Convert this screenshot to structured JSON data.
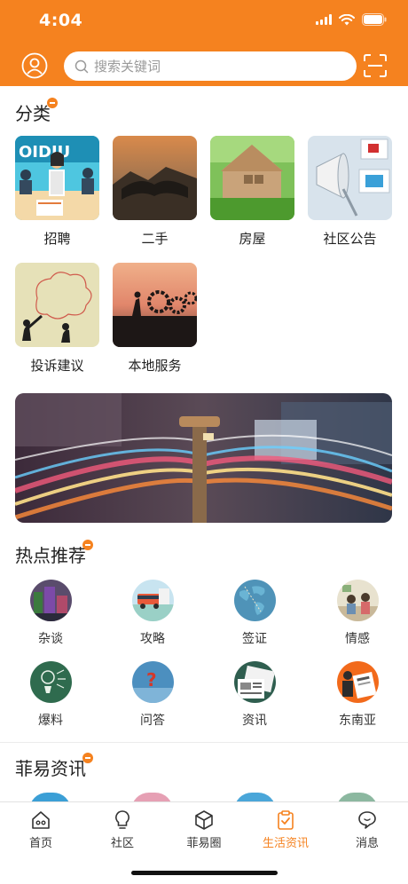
{
  "status_bar": {
    "time": "4:04"
  },
  "header": {
    "search_placeholder": "搜索关键词"
  },
  "categories_section": {
    "title": "分类",
    "items": [
      {
        "label": "招聘"
      },
      {
        "label": "二手"
      },
      {
        "label": "房屋"
      },
      {
        "label": "社区公告"
      },
      {
        "label": "投诉建议"
      },
      {
        "label": "本地服务"
      }
    ]
  },
  "hot_section": {
    "title": "热点推荐",
    "items": [
      {
        "label": "杂谈"
      },
      {
        "label": "攻略"
      },
      {
        "label": "签证"
      },
      {
        "label": "情感"
      },
      {
        "label": "爆料"
      },
      {
        "label": "问答"
      },
      {
        "label": "资讯"
      },
      {
        "label": "东南亚"
      }
    ]
  },
  "news_section": {
    "title": "菲易资讯"
  },
  "tabbar": {
    "items": [
      {
        "label": "首页"
      },
      {
        "label": "社区"
      },
      {
        "label": "菲易圈"
      },
      {
        "label": "生活资讯"
      },
      {
        "label": "消息"
      }
    ],
    "active": "生活资讯"
  },
  "colors": {
    "accent": "#f5821f",
    "text": "#222222"
  }
}
